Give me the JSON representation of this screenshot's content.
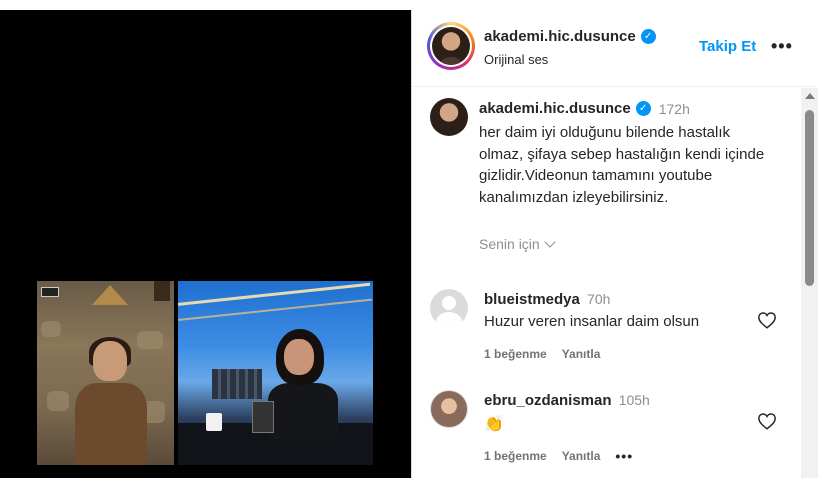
{
  "post": {
    "username": "akademi.hic.dusunce",
    "audio_label": "Orijinal ses",
    "follow_label": "Takip Et",
    "more_label": "•••"
  },
  "caption": {
    "username": "akademi.hic.dusunce",
    "time": "172h",
    "text": "her daim iyi olduğunu bilende hastalık olmaz, şifaya sebep hastalığın kendi içinde gizlidir.Videonun tamamını youtube kanalımızdan izleyebilirsiniz.",
    "for_you_label": "Senin için"
  },
  "comments": [
    {
      "username": "blueistmedya",
      "time": "70h",
      "text": "Huzur veren insanlar daim olsun",
      "likes_label": "1 beğenme",
      "reply_label": "Yanıtla",
      "avatar": "default-avatar-icon"
    },
    {
      "username": "ebru_ozdanisman",
      "time": "105h",
      "text": "👏",
      "likes_label": "1 beğenme",
      "reply_label": "Yanıtla",
      "more_label": "•••",
      "avatar": "user-photo"
    }
  ],
  "colors": {
    "accent": "#0095f6",
    "text": "#262626",
    "muted": "#8e8e8e",
    "video_bg": "#000000"
  }
}
